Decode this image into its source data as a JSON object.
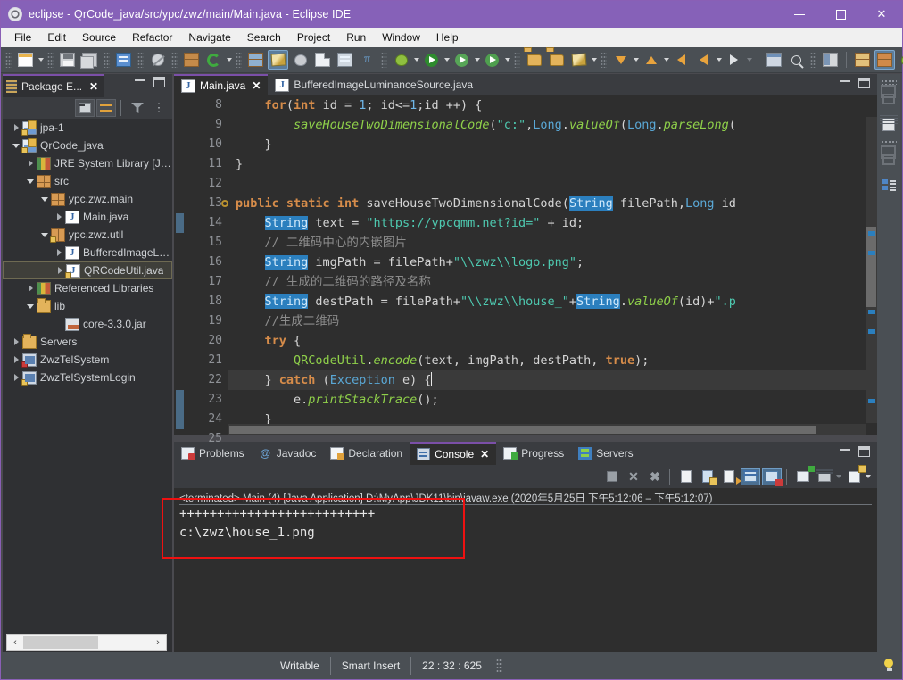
{
  "window": {
    "title": "eclipse - QrCode_java/src/ypc/zwz/main/Main.java - Eclipse IDE",
    "app_icon": "eclipse-gear-icon",
    "minimize": "–",
    "maximize": "□",
    "close": "✕"
  },
  "menubar": {
    "items": [
      "File",
      "Edit",
      "Source",
      "Refactor",
      "Navigate",
      "Search",
      "Project",
      "Run",
      "Window",
      "Help"
    ]
  },
  "toolbar": {
    "items": [
      {
        "name": "new-wizard-icon",
        "glyph": "new"
      },
      {
        "name": "new-dropdown-icon",
        "glyph": "caret"
      },
      {
        "name": "save-icon",
        "glyph": "save"
      },
      {
        "name": "save-all-icon",
        "glyph": "saveall"
      },
      {
        "name": "print-icon",
        "glyph": "print"
      },
      {
        "name": "toggle-mark-occurrences-icon",
        "glyph": "noedit"
      },
      {
        "name": "new-java-package-icon",
        "glyph": "pkg"
      },
      {
        "name": "new-java-class-icon",
        "glyph": "greenc"
      },
      {
        "name": "new-java-class-dropdown-icon",
        "glyph": "caret"
      },
      {
        "name": "debug-icon",
        "glyph": "debugrun"
      },
      {
        "name": "run-external-tools-icon",
        "glyph": "pen"
      },
      {
        "name": "skip-breakpoints-icon",
        "glyph": "bug-skip"
      },
      {
        "name": "open-type-icon",
        "glyph": "opentype"
      },
      {
        "name": "open-task-icon",
        "glyph": "tasklist"
      },
      {
        "name": "pi-icon",
        "glyph": "pi"
      },
      {
        "name": "debug-run-icon",
        "glyph": "debugbug"
      },
      {
        "name": "debug-dropdown-icon",
        "glyph": "caret"
      },
      {
        "name": "run-icon",
        "glyph": "run"
      },
      {
        "name": "run-dropdown-icon",
        "glyph": "caret"
      },
      {
        "name": "coverage-icon",
        "glyph": "coverage"
      },
      {
        "name": "coverage-dropdown-icon",
        "glyph": "caret"
      },
      {
        "name": "run-last-icon",
        "glyph": "runlast"
      },
      {
        "name": "run-last-dropdown-icon",
        "glyph": "caret"
      },
      {
        "name": "open-folder-icon",
        "glyph": "folderopen"
      },
      {
        "name": "open-resource-icon",
        "glyph": "folder"
      },
      {
        "name": "edit-icon",
        "glyph": "pen2"
      },
      {
        "name": "edit-dropdown-icon",
        "glyph": "caret"
      },
      {
        "name": "next-annotation-icon",
        "glyph": "arrowdown"
      },
      {
        "name": "next-annotation-dropdown-icon",
        "glyph": "caret"
      },
      {
        "name": "previous-annotation-icon",
        "glyph": "arrowup"
      },
      {
        "name": "previous-annotation-dropdown-icon",
        "glyph": "caret"
      },
      {
        "name": "last-edit-location-icon",
        "glyph": "backedit"
      },
      {
        "name": "back-icon",
        "glyph": "back"
      },
      {
        "name": "back-dropdown-icon",
        "glyph": "caret"
      },
      {
        "name": "forward-icon",
        "glyph": "forward"
      },
      {
        "name": "forward-dropdown-icon",
        "glyph": "caret-dim"
      },
      {
        "name": "pin-editor-icon",
        "glyph": "pineditor"
      },
      {
        "name": "search-icon",
        "glyph": "search"
      },
      {
        "name": "open-perspective-icon",
        "glyph": "newperspective"
      },
      {
        "name": "perspective-java-ee-icon",
        "glyph": "javaee"
      },
      {
        "name": "perspective-java-icon",
        "glyph": "javaperspective"
      },
      {
        "name": "perspective-debug-icon",
        "glyph": "debugperspective"
      }
    ]
  },
  "package_explorer": {
    "title": "Package E...",
    "close": "✕",
    "toolbar": [
      {
        "name": "collapse-all-icon"
      },
      {
        "name": "link-with-editor-icon"
      },
      {
        "name": "view-filter-icon"
      },
      {
        "name": "view-menu-icon"
      }
    ],
    "tree": [
      {
        "label": "jpa-1",
        "indent": 0,
        "twisty": "collapsed",
        "icon": "java-project-icon"
      },
      {
        "label": "QrCode_java",
        "indent": 0,
        "twisty": "expanded",
        "icon": "java-project-icon"
      },
      {
        "label": "JRE System Library [J…",
        "indent": 1,
        "twisty": "collapsed",
        "icon": "library-icon"
      },
      {
        "label": "src",
        "indent": 1,
        "twisty": "expanded",
        "icon": "source-folder-icon"
      },
      {
        "label": "ypc.zwz.main",
        "indent": 2,
        "twisty": "expanded",
        "icon": "package-icon"
      },
      {
        "label": "Main.java",
        "indent": 3,
        "twisty": "collapsed",
        "icon": "java-file-icon"
      },
      {
        "label": "ypc.zwz.util",
        "indent": 2,
        "twisty": "expanded",
        "icon": "package-icon"
      },
      {
        "label": "BufferedImageL…",
        "indent": 3,
        "twisty": "collapsed",
        "icon": "java-file-icon"
      },
      {
        "label": "QRCodeUtil.java",
        "indent": 3,
        "twisty": "collapsed",
        "icon": "java-file-icon",
        "selected": true
      },
      {
        "label": "Referenced Libraries",
        "indent": 1,
        "twisty": "collapsed",
        "icon": "library-icon"
      },
      {
        "label": "lib",
        "indent": 1,
        "twisty": "expanded",
        "icon": "folder-icon"
      },
      {
        "label": "core-3.3.0.jar",
        "indent": 2,
        "twisty": "none",
        "icon": "jar-icon"
      },
      {
        "label": "Servers",
        "indent": 0,
        "twisty": "collapsed",
        "icon": "folder-icon"
      },
      {
        "label": "ZwzTelSystem",
        "indent": 0,
        "twisty": "collapsed",
        "icon": "web-project-icon"
      },
      {
        "label": "ZwzTelSystemLogin",
        "indent": 0,
        "twisty": "collapsed",
        "icon": "web-project-icon"
      }
    ],
    "hscroll": {
      "left_arrow": "‹",
      "right_arrow": "›"
    }
  },
  "editor": {
    "tabs": [
      {
        "label": "Main.java",
        "active": true,
        "close": "✕"
      },
      {
        "label": "BufferedImageLuminanceSource.java",
        "active": false
      }
    ],
    "line_numbers": [
      "8",
      "9",
      "10",
      "11",
      "12",
      "13",
      "14",
      "15",
      "16",
      "17",
      "18",
      "19",
      "20",
      "21",
      "22",
      "23",
      "24",
      "25"
    ],
    "breakpoint_line": "13",
    "current_line": "22",
    "lines": [
      [
        {
          "t": "    ",
          "c": "plain"
        },
        {
          "t": "for",
          "c": "kw"
        },
        {
          "t": "(",
          "c": "plain"
        },
        {
          "t": "int",
          "c": "kw"
        },
        {
          "t": " id = ",
          "c": "plain"
        },
        {
          "t": "1",
          "c": "num"
        },
        {
          "t": "; id<=",
          "c": "plain"
        },
        {
          "t": "1",
          "c": "num"
        },
        {
          "t": ";id ++) {",
          "c": "plain"
        }
      ],
      [
        {
          "t": "        ",
          "c": "plain"
        },
        {
          "t": "saveHouseTwoDimensionalCode",
          "c": "mth"
        },
        {
          "t": "(",
          "c": "plain"
        },
        {
          "t": "\"c:\"",
          "c": "str"
        },
        {
          "t": ",",
          "c": "plain"
        },
        {
          "t": "Long",
          "c": "type"
        },
        {
          "t": ".",
          "c": "plain"
        },
        {
          "t": "valueOf",
          "c": "mth"
        },
        {
          "t": "(",
          "c": "plain"
        },
        {
          "t": "Long",
          "c": "type"
        },
        {
          "t": ".",
          "c": "plain"
        },
        {
          "t": "parseLong",
          "c": "mth"
        },
        {
          "t": "(",
          "c": "plain"
        }
      ],
      [
        {
          "t": "    }",
          "c": "plain"
        }
      ],
      [
        {
          "t": "}",
          "c": "plain"
        }
      ],
      [
        {
          "t": "",
          "c": "plain"
        }
      ],
      [
        {
          "t": "public",
          "c": "kw"
        },
        {
          "t": " ",
          "c": "plain"
        },
        {
          "t": "static",
          "c": "kw"
        },
        {
          "t": " ",
          "c": "plain"
        },
        {
          "t": "int",
          "c": "kw"
        },
        {
          "t": " saveHouseTwoDimensionalCode(",
          "c": "plain"
        },
        {
          "t": "String",
          "c": "hl"
        },
        {
          "t": " filePath,",
          "c": "plain"
        },
        {
          "t": "Long",
          "c": "type"
        },
        {
          "t": " id",
          "c": "plain"
        }
      ],
      [
        {
          "t": "    ",
          "c": "plain"
        },
        {
          "t": "String",
          "c": "hl"
        },
        {
          "t": " text = ",
          "c": "plain"
        },
        {
          "t": "\"https://ypcqmm.net?id=\"",
          "c": "str"
        },
        {
          "t": " + id;",
          "c": "plain"
        }
      ],
      [
        {
          "t": "    ",
          "c": "plain"
        },
        {
          "t": "// 二维码中心的内嵌图片",
          "c": "cmt"
        }
      ],
      [
        {
          "t": "    ",
          "c": "plain"
        },
        {
          "t": "String",
          "c": "hl"
        },
        {
          "t": " imgPath = filePath+",
          "c": "plain"
        },
        {
          "t": "\"\\\\zwz\\\\logo.png\"",
          "c": "str"
        },
        {
          "t": ";",
          "c": "plain"
        }
      ],
      [
        {
          "t": "    ",
          "c": "plain"
        },
        {
          "t": "// 生成的二维码的路径及名称",
          "c": "cmt"
        }
      ],
      [
        {
          "t": "    ",
          "c": "plain"
        },
        {
          "t": "String",
          "c": "hl"
        },
        {
          "t": " destPath = filePath+",
          "c": "plain"
        },
        {
          "t": "\"\\\\zwz\\\\house_\"",
          "c": "str"
        },
        {
          "t": "+",
          "c": "plain"
        },
        {
          "t": "String",
          "c": "hl"
        },
        {
          "t": ".",
          "c": "plain"
        },
        {
          "t": "valueOf",
          "c": "mth"
        },
        {
          "t": "(id)+",
          "c": "plain"
        },
        {
          "t": "\".p",
          "c": "str"
        }
      ],
      [
        {
          "t": "    ",
          "c": "plain"
        },
        {
          "t": "//生成二维码",
          "c": "cmt"
        }
      ],
      [
        {
          "t": "    ",
          "c": "plain"
        },
        {
          "t": "try",
          "c": "kw"
        },
        {
          "t": " {",
          "c": "plain"
        }
      ],
      [
        {
          "t": "        ",
          "c": "plain"
        },
        {
          "t": "QRCodeUtil",
          "c": "mthn"
        },
        {
          "t": ".",
          "c": "plain"
        },
        {
          "t": "encode",
          "c": "mth"
        },
        {
          "t": "(text, imgPath, destPath, ",
          "c": "plain"
        },
        {
          "t": "true",
          "c": "kw"
        },
        {
          "t": ");",
          "c": "plain"
        }
      ],
      [
        {
          "t": "    } ",
          "c": "plain"
        },
        {
          "t": "catch",
          "c": "kw"
        },
        {
          "t": " (",
          "c": "plain"
        },
        {
          "t": "Exception",
          "c": "type"
        },
        {
          "t": " e) {",
          "c": "plain"
        }
      ],
      [
        {
          "t": "        e.",
          "c": "plain"
        },
        {
          "t": "printStackTrace",
          "c": "mth"
        },
        {
          "t": "();",
          "c": "plain"
        }
      ],
      [
        {
          "t": "    }",
          "c": "plain"
        }
      ],
      [
        {
          "t": "",
          "c": "plain"
        }
      ]
    ]
  },
  "console_panel": {
    "tabs": [
      {
        "label": "Problems",
        "icon": "problems-icon",
        "active": false
      },
      {
        "label": "Javadoc",
        "icon": "javadoc-icon",
        "active": false
      },
      {
        "label": "Declaration",
        "icon": "declaration-icon",
        "active": false
      },
      {
        "label": "Console",
        "icon": "console-icon",
        "active": true,
        "close": "✕"
      },
      {
        "label": "Progress",
        "icon": "progress-icon",
        "active": false
      },
      {
        "label": "Servers",
        "icon": "servers-icon",
        "active": false
      }
    ],
    "toolbar": [
      {
        "name": "terminate-icon"
      },
      {
        "name": "remove-launch-icon"
      },
      {
        "name": "remove-all-terminated-icon"
      },
      {
        "name": "clear-console-icon"
      },
      {
        "name": "scroll-lock-icon"
      },
      {
        "name": "word-wrap-icon"
      },
      {
        "name": "show-console-on-output-icon",
        "active": true
      },
      {
        "name": "show-console-on-error-icon",
        "active": true
      },
      {
        "name": "pin-console-icon"
      },
      {
        "name": "display-selected-console-icon"
      },
      {
        "name": "display-console-dropdown-icon"
      },
      {
        "name": "open-console-icon"
      },
      {
        "name": "open-console-dropdown-icon"
      }
    ],
    "header": "<terminated> Main (4) [Java Application] D:\\MyApp\\JDK11\\bin\\javaw.exe  (2020年5月25日 下午5:12:06 – 下午5:12:07)",
    "output": [
      "++++++++++++++++++++++++++",
      "c:\\zwz\\house_1.png"
    ],
    "highlight_color": "#ee1111"
  },
  "right_trim": {
    "items": [
      {
        "name": "restore-view-icon"
      },
      {
        "name": "outline-view-icon"
      },
      {
        "name": "restore-view-icon-2"
      },
      {
        "name": "properties-view-icon"
      }
    ]
  },
  "statusbar": {
    "writable": "Writable",
    "insert_mode": "Smart Insert",
    "position": "22 : 32 : 625",
    "tip_icon": "lightbulb-icon"
  }
}
